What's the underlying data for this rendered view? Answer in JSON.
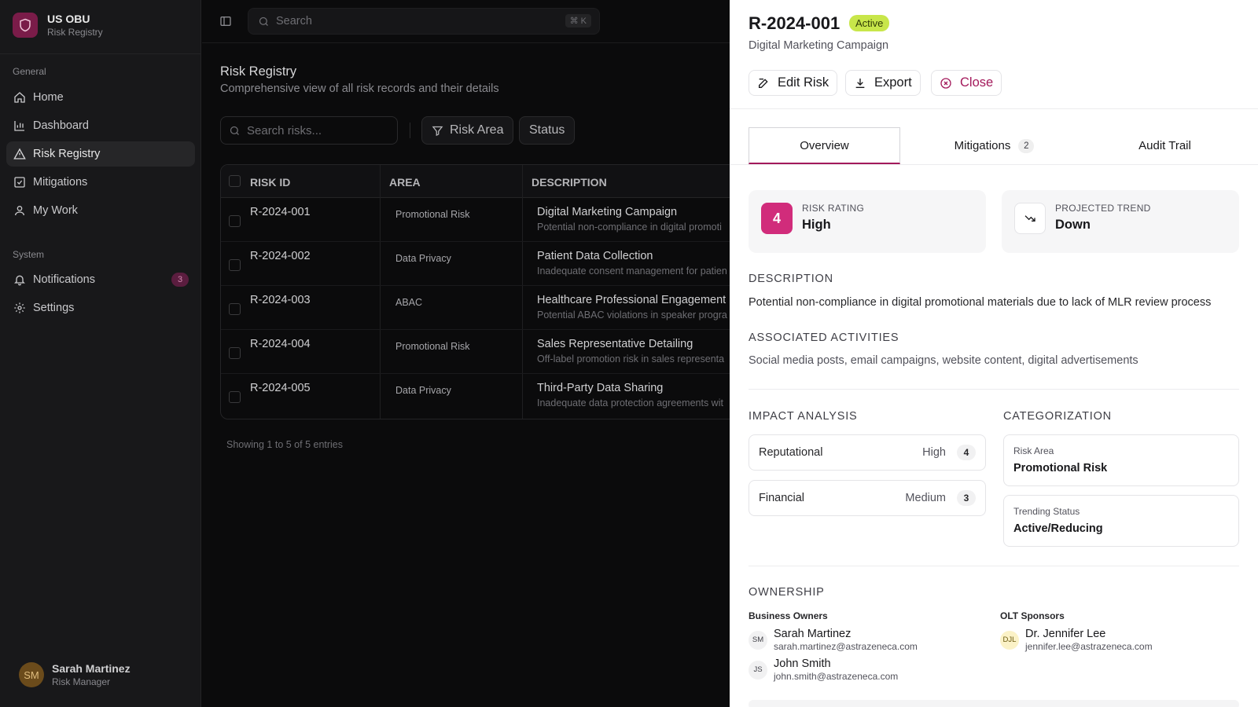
{
  "brand": {
    "title": "US OBU",
    "subtitle": "Risk Registry",
    "logo_icon": "shield-icon"
  },
  "sidebar": {
    "sections": [
      {
        "label": "General"
      },
      {
        "label": "System"
      }
    ],
    "items": [
      {
        "label": "Home",
        "icon": "home-icon"
      },
      {
        "label": "Dashboard",
        "icon": "bar-chart-icon"
      },
      {
        "label": "Risk Registry",
        "icon": "warning-triangle-icon",
        "active": true
      },
      {
        "label": "Mitigations",
        "icon": "checkbox-icon"
      },
      {
        "label": "My Work",
        "icon": "user-icon"
      },
      {
        "label": "Notifications",
        "icon": "bell-icon",
        "badge": "3"
      },
      {
        "label": "Settings",
        "icon": "gear-icon"
      }
    ],
    "user": {
      "initials": "SM",
      "name": "Sarah Martinez",
      "role": "Risk Manager"
    }
  },
  "topbar": {
    "search_placeholder": "Search",
    "shortcut": "⌘ K"
  },
  "page": {
    "title": "Risk Registry",
    "subtitle": "Comprehensive view of all risk records and their details",
    "search_placeholder": "Search risks...",
    "filters": [
      "Risk Area",
      "Status"
    ]
  },
  "table": {
    "headers": [
      "RISK ID",
      "AREA",
      "DESCRIPTION"
    ],
    "rows": [
      {
        "id": "R-2024-001",
        "area": "Promotional Risk",
        "title": "Digital Marketing Campaign",
        "desc": "Potential non-compliance in digital promoti"
      },
      {
        "id": "R-2024-002",
        "area": "Data Privacy",
        "title": "Patient Data Collection",
        "desc": "Inadequate consent management for patien"
      },
      {
        "id": "R-2024-003",
        "area": "ABAC",
        "title": "Healthcare Professional Engagement",
        "desc": "Potential ABAC violations in speaker progra"
      },
      {
        "id": "R-2024-004",
        "area": "Promotional Risk",
        "title": "Sales Representative Detailing",
        "desc": "Off-label promotion risk in sales representa"
      },
      {
        "id": "R-2024-005",
        "area": "Data Privacy",
        "title": "Third-Party Data Sharing",
        "desc": "Inadequate data protection agreements wit"
      }
    ],
    "showing": "Showing 1 to 5 of 5 entries"
  },
  "detail": {
    "id": "R-2024-001",
    "status": "Active",
    "subtitle": "Digital Marketing Campaign",
    "buttons": {
      "edit": "Edit Risk",
      "export": "Export",
      "close": "Close"
    },
    "tabs": [
      {
        "label": "Overview",
        "active": true
      },
      {
        "label": "Mitigations",
        "count": "2"
      },
      {
        "label": "Audit Trail"
      }
    ],
    "rating": {
      "label": "RISK RATING",
      "number": "4",
      "value": "High"
    },
    "trend": {
      "label": "PROJECTED TREND",
      "value": "Down",
      "icon": "trending-down-icon"
    },
    "description": {
      "heading": "DESCRIPTION",
      "text": "Potential non-compliance in digital promotional materials due to lack of MLR review process"
    },
    "activities": {
      "heading": "ASSOCIATED ACTIVITIES",
      "text": "Social media posts, email campaigns, website content, digital advertisements"
    },
    "impact": {
      "heading": "IMPACT ANALYSIS",
      "rows": [
        {
          "name": "Reputational",
          "level": "High",
          "score": "4"
        },
        {
          "name": "Financial",
          "level": "Medium",
          "score": "3"
        }
      ]
    },
    "categorization": {
      "heading": "CATEGORIZATION",
      "items": [
        {
          "label": "Risk Area",
          "value": "Promotional Risk"
        },
        {
          "label": "Trending Status",
          "value": "Active/Reducing"
        }
      ]
    },
    "ownership": {
      "heading": "OWNERSHIP",
      "business_owners_label": "Business Owners",
      "sponsors_label": "OLT Sponsors",
      "business_owners": [
        {
          "initials": "SM",
          "name": "Sarah Martinez",
          "email": "sarah.martinez@astrazeneca.com"
        },
        {
          "initials": "JS",
          "name": "John Smith",
          "email": "john.smith@astrazeneca.com"
        }
      ],
      "sponsors": [
        {
          "initials": "DJL",
          "name": "Dr. Jennifer Lee",
          "email": "jennifer.lee@astrazeneca.com"
        }
      ]
    }
  },
  "colors": {
    "accent": "#a3195b",
    "rating": "#d12c7b",
    "active_badge": "#c8e64a"
  }
}
